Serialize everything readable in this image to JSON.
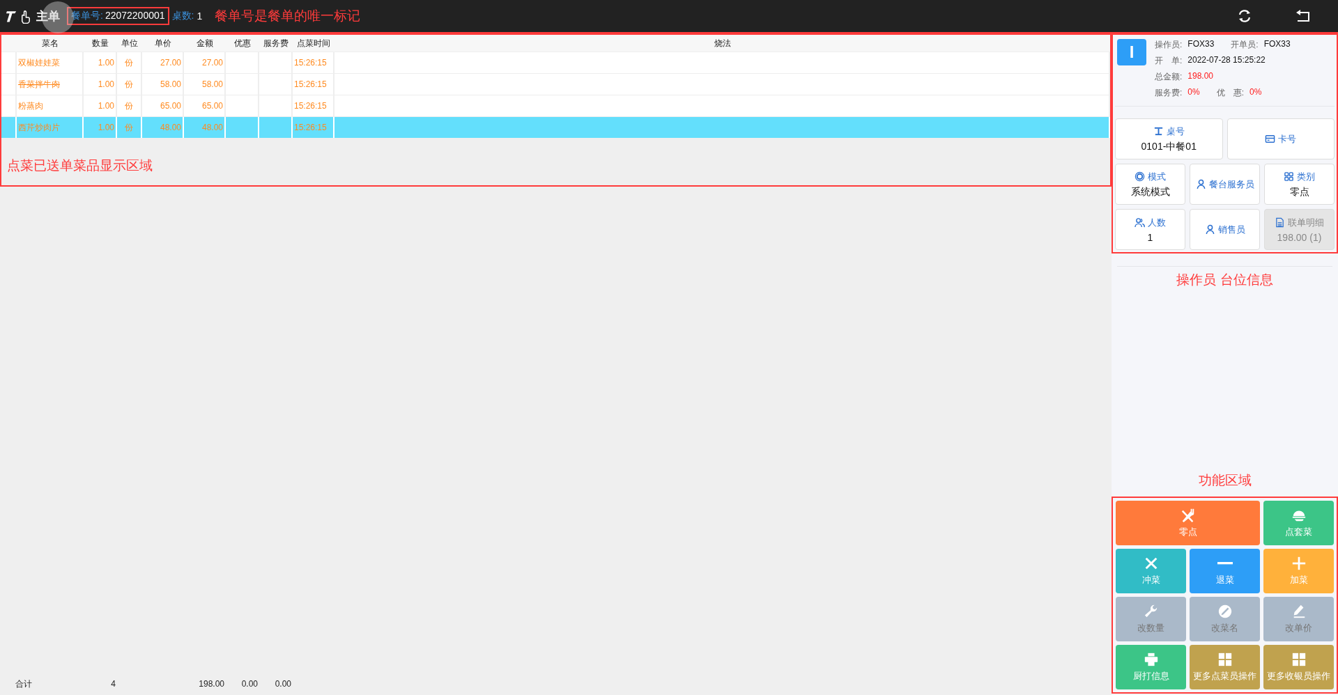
{
  "header": {
    "title": "主单",
    "order_label": "餐单号:",
    "order_no": "22072200001",
    "table_count_label": "桌数:",
    "table_count": "1",
    "annotation": "餐单号是餐单的唯一标记"
  },
  "table": {
    "columns": [
      "菜名",
      "数量",
      "单位",
      "单价",
      "金额",
      "优惠",
      "服务费",
      "点菜时间",
      "烧法"
    ],
    "rows": [
      {
        "cells": [
          "双椒娃娃菜",
          "1.00",
          "份",
          "27.00",
          "27.00",
          "",
          "",
          "15:26:15",
          ""
        ],
        "selected": false,
        "struck": false
      },
      {
        "cells": [
          "香菜拌牛肉",
          "1.00",
          "份",
          "58.00",
          "58.00",
          "",
          "",
          "15:26:15",
          ""
        ],
        "selected": false,
        "struck": true
      },
      {
        "cells": [
          "粉蒸肉",
          "1.00",
          "份",
          "65.00",
          "65.00",
          "",
          "",
          "15:26:15",
          ""
        ],
        "selected": false,
        "struck": false
      },
      {
        "cells": [
          "西芹炒肉片",
          "1.00",
          "份",
          "48.00",
          "48.00",
          "",
          "",
          "15:26:15",
          ""
        ],
        "selected": true,
        "struck": false
      }
    ],
    "annotation": "点菜已送单菜品显示区域",
    "totals": {
      "label": "合计",
      "quantity": "4",
      "amount": "198.00",
      "discount": "0.00",
      "service": "0.00"
    }
  },
  "info": {
    "avatar": "I",
    "rows": [
      [
        {
          "label": "操作员:",
          "value": "FOX33",
          "highlight": false
        },
        {
          "label": "开单员:",
          "value": "FOX33",
          "highlight": false
        }
      ],
      [
        {
          "label": "开　单:",
          "value": "2022-07-28 15:25:22",
          "highlight": false
        }
      ],
      [
        {
          "label": "总金额:",
          "value": "198.00",
          "highlight": true
        }
      ],
      [
        {
          "label": "服务费:",
          "value": "0%",
          "highlight": true
        },
        {
          "label": "优　惠:",
          "value": "0%",
          "highlight": true
        }
      ]
    ],
    "cards": [
      {
        "label": "桌号",
        "value": "0101-中餐01",
        "disabled": false
      },
      {
        "label": "卡号",
        "disabled": false
      },
      {
        "label": "模式",
        "value": "系统模式",
        "disabled": false
      },
      {
        "label": "餐台服务员",
        "disabled": false
      },
      {
        "label": "类别",
        "value": "零点",
        "disabled": false
      },
      {
        "label": "人数",
        "value": "1",
        "disabled": false
      },
      {
        "label": "销售员",
        "disabled": false
      },
      {
        "label": "联单明细",
        "value": "198.00 (1)",
        "disabled": true
      }
    ],
    "annotation": "操作员 台位信息"
  },
  "functions": {
    "annotation": "功能区域",
    "actions": [
      {
        "label": "零点",
        "color": "#ff7a3b",
        "disabled": false
      },
      {
        "label": "点套菜",
        "color": "#3cc587",
        "disabled": false
      },
      {
        "label": "冲菜",
        "color": "#31bcc6",
        "disabled": false
      },
      {
        "label": "退菜",
        "color": "#2d9ef7",
        "disabled": false
      },
      {
        "label": "加菜",
        "color": "#ffb13b",
        "disabled": false
      },
      {
        "label": "改数量",
        "color": "#aab9c9",
        "disabled": true
      },
      {
        "label": "改菜名",
        "color": "#aab9c9",
        "disabled": true
      },
      {
        "label": "改单价",
        "color": "#aab9c9",
        "disabled": true
      },
      {
        "label": "厨打信息",
        "color": "#3cc587",
        "disabled": false
      },
      {
        "label": "更多点菜员操作",
        "color": "#c0a24e",
        "disabled": false
      },
      {
        "label": "更多收银员操作",
        "color": "#c0a24e",
        "disabled": false
      }
    ]
  }
}
